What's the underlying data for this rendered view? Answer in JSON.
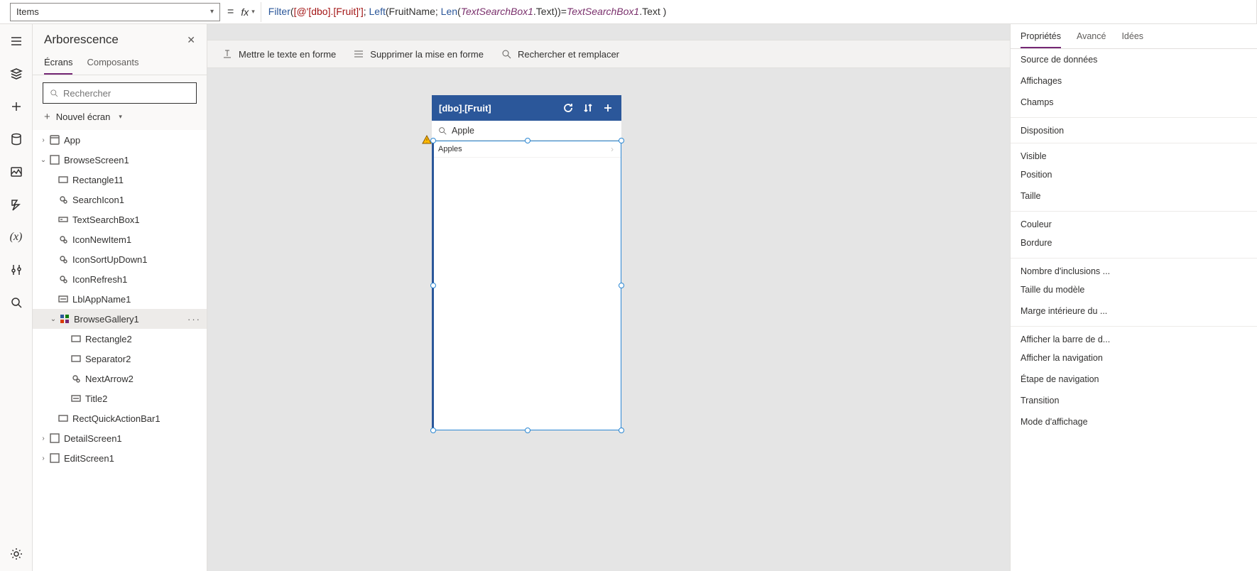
{
  "formula": {
    "property": "Items",
    "tokens": [
      {
        "t": "fn",
        "v": "Filter"
      },
      {
        "t": "plain",
        "v": "("
      },
      {
        "t": "str",
        "v": "[@'[dbo].[Fruit]']"
      },
      {
        "t": "plain",
        "v": "; "
      },
      {
        "t": "fn",
        "v": "Left"
      },
      {
        "t": "plain",
        "v": "(FruitName; "
      },
      {
        "t": "fn",
        "v": "Len"
      },
      {
        "t": "plain",
        "v": "("
      },
      {
        "t": "ctx",
        "v": "TextSearchBox1"
      },
      {
        "t": "plain",
        "v": ".Text))="
      },
      {
        "t": "ctx",
        "v": "TextSearchBox1"
      },
      {
        "t": "plain",
        "v": ".Text )"
      }
    ]
  },
  "toolbar": {
    "format": "Mettre le texte en forme",
    "strip": "Supprimer la mise en forme",
    "find": "Rechercher et remplacer"
  },
  "tree": {
    "title": "Arborescence",
    "tab_screens": "Écrans",
    "tab_components": "Composants",
    "search_placeholder": "Rechercher",
    "new_screen": "Nouvel écran",
    "app": "App",
    "browseScreen": "BrowseScreen1",
    "rectangle11": "Rectangle11",
    "searchIcon1": "SearchIcon1",
    "textSearchBox1": "TextSearchBox1",
    "iconNewItem1": "IconNewItem1",
    "iconSortUpDown1": "IconSortUpDown1",
    "iconRefresh1": "IconRefresh1",
    "lblAppName1": "LblAppName1",
    "browseGallery1": "BrowseGallery1",
    "rectangle2": "Rectangle2",
    "separator2": "Separator2",
    "nextArrow2": "NextArrow2",
    "title2": "Title2",
    "rectQuickActionBar1": "RectQuickActionBar1",
    "detailScreen1": "DetailScreen1",
    "editScreen1": "EditScreen1"
  },
  "phone": {
    "title": "[dbo].[Fruit]",
    "search_value": "Apple",
    "row0": "Apples"
  },
  "props": {
    "tab_props": "Propriétés",
    "tab_adv": "Avancé",
    "tab_ideas": "Idées",
    "dataSource": "Source de données",
    "views": "Affichages",
    "fields": "Champs",
    "layout": "Disposition",
    "visible": "Visible",
    "position": "Position",
    "size": "Taille",
    "color": "Couleur",
    "border": "Bordure",
    "wrapCount": "Nombre d'inclusions ...",
    "templateSize": "Taille du modèle",
    "templatePadding": "Marge intérieure du ...",
    "showScrollbar": "Afficher la barre de d...",
    "showNav": "Afficher la navigation",
    "navStep": "Étape de navigation",
    "transition": "Transition",
    "displayMode": "Mode d'affichage"
  }
}
